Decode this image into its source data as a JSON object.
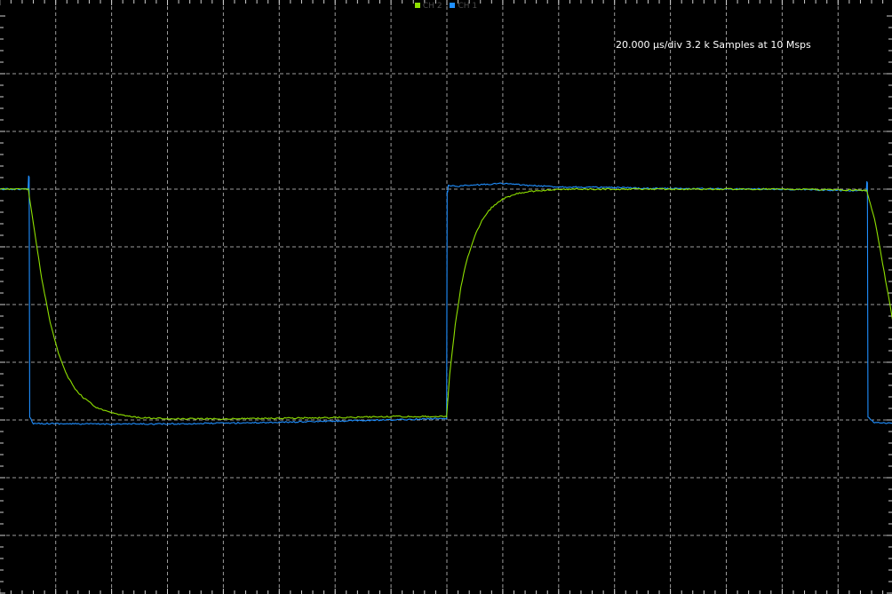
{
  "colors": {
    "background": "#000000",
    "grid": "#cfcfcf",
    "ch1": "#1f8fff",
    "ch2": "#8ee000"
  },
  "legend": {
    "items": [
      {
        "label": "CH 2",
        "color": "#8ee000"
      },
      {
        "label": "CH 1",
        "color": "#1f8fff"
      }
    ]
  },
  "info": {
    "text": "20.000 µs/div 3.2 k Samples at 10 Msps"
  },
  "chart_data": {
    "type": "line",
    "title": "",
    "xlabel": "",
    "ylabel": "",
    "x_unit": "µs",
    "x_per_division": 20,
    "x_divisions": 16,
    "y_divisions": 10,
    "xlim": [
      0,
      320
    ],
    "ylim": [
      -5,
      5
    ],
    "grid": true,
    "legend_position": "top-center",
    "series": [
      {
        "name": "CH 1",
        "color": "#1f8fff",
        "x": [
          0,
          10.1,
          10.3,
          10.5,
          10.7,
          12,
          15,
          30,
          60,
          100,
          140,
          159.9,
          160.1,
          160.3,
          160.5,
          163,
          180,
          190,
          200,
          240,
          280,
          310.1,
          310.3,
          310.5,
          310.7,
          313,
          320
        ],
        "y": [
          2.0,
          2.0,
          2.22,
          2.22,
          -1.95,
          -2.06,
          -2.06,
          -2.07,
          -2.07,
          -2.04,
          -2.0,
          -1.97,
          1.96,
          1.96,
          2.06,
          2.05,
          2.1,
          2.06,
          2.04,
          2.01,
          2.0,
          1.97,
          2.12,
          2.12,
          -1.95,
          -2.05,
          -2.06
        ]
      },
      {
        "name": "CH 2",
        "color": "#8ee000",
        "x": [
          0,
          10.2,
          12,
          15,
          18,
          21,
          24,
          27,
          30,
          35,
          40,
          45,
          50,
          55,
          60,
          70,
          80,
          100,
          120,
          140,
          159.9,
          161,
          163,
          165,
          167,
          170,
          173,
          176,
          180,
          185,
          190,
          195,
          200,
          210,
          220,
          240,
          260,
          280,
          300,
          310.2,
          313,
          316,
          320
        ],
        "y": [
          2.0,
          2.0,
          1.4,
          0.45,
          -0.3,
          -0.85,
          -1.22,
          -1.47,
          -1.62,
          -1.8,
          -1.88,
          -1.93,
          -1.96,
          -1.97,
          -1.98,
          -1.98,
          -1.98,
          -1.97,
          -1.96,
          -1.94,
          -1.94,
          -1.2,
          -0.35,
          0.3,
          0.75,
          1.2,
          1.5,
          1.68,
          1.83,
          1.92,
          1.96,
          1.98,
          2.0,
          2.0,
          2.0,
          2.0,
          2.0,
          2.0,
          1.99,
          1.98,
          1.5,
          0.7,
          -0.4
        ]
      }
    ]
  }
}
